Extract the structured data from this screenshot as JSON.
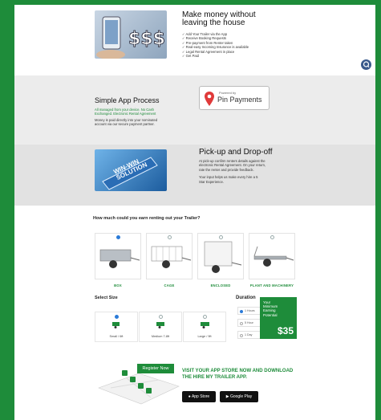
{
  "hero": {
    "title_line1": "Make money without",
    "title_line2": "leaving the house",
    "bullets": [
      "✓ Add Your Trailer via the App",
      "✓ Receive Booking Requests",
      "✓ Pre-payment from Renter taken",
      "✓ Real-easy Incoming Insurance is available",
      "✓ Legal Rental Agreement in place",
      "✓ Get Paid"
    ]
  },
  "process": {
    "title": "Simple App Process",
    "green_line1": "All managed from your device. No Cash",
    "green_line2": "Exchanged. Electronic Rental Agreement",
    "body_line1": "Money is paid directly into your nominated",
    "body_line2": "account via our secure payment partner.",
    "badge_powered": "Powered by",
    "badge_brand": "Pin Payments"
  },
  "pickup": {
    "title": "Pick-up and Drop-off",
    "body_line1": "At pick-up confirm renters details against the",
    "body_line2": "electronic Rental Agreement. On your return,",
    "body_line3": "rate the renter and provide feedback.",
    "body_line4": "Your input helps us make every hire a 5",
    "body_line5": "Star Experience.",
    "image_text_line1": "WIN-WIN",
    "image_text_line2": "SOLUTION"
  },
  "calculator": {
    "question": "How much could you earn renting out your Trailer?",
    "trailer_types": [
      "BOX",
      "CAGE",
      "ENCLOSED",
      "PLANT AND MACHINERY"
    ],
    "select_size_label": "Select Size",
    "sizes": [
      "Small / 6ft",
      "Medium 7-8ft",
      "Large / 9ft"
    ],
    "duration_label": "Duration",
    "durations": [
      "1 Hours",
      "5 Hour",
      "1 Day"
    ],
    "earning_line1": "Your",
    "earning_line2": "Minimum",
    "earning_line3": "Earning",
    "earning_line4": "Potential",
    "earning_value": "$35"
  },
  "cta": {
    "register_label": "Register Now",
    "headline_line1": "VISIT YOUR APP STORE NOW AND DOWNLOAD",
    "headline_line2": "THE HIRE MY TRAILER APP.",
    "app_store_label": "App Store",
    "google_play_label": "Google Play"
  },
  "colors": {
    "brand_green": "#1e8c3a",
    "chat_button": "#3a5a8c"
  },
  "icons": {
    "chat": "chat-icon"
  }
}
